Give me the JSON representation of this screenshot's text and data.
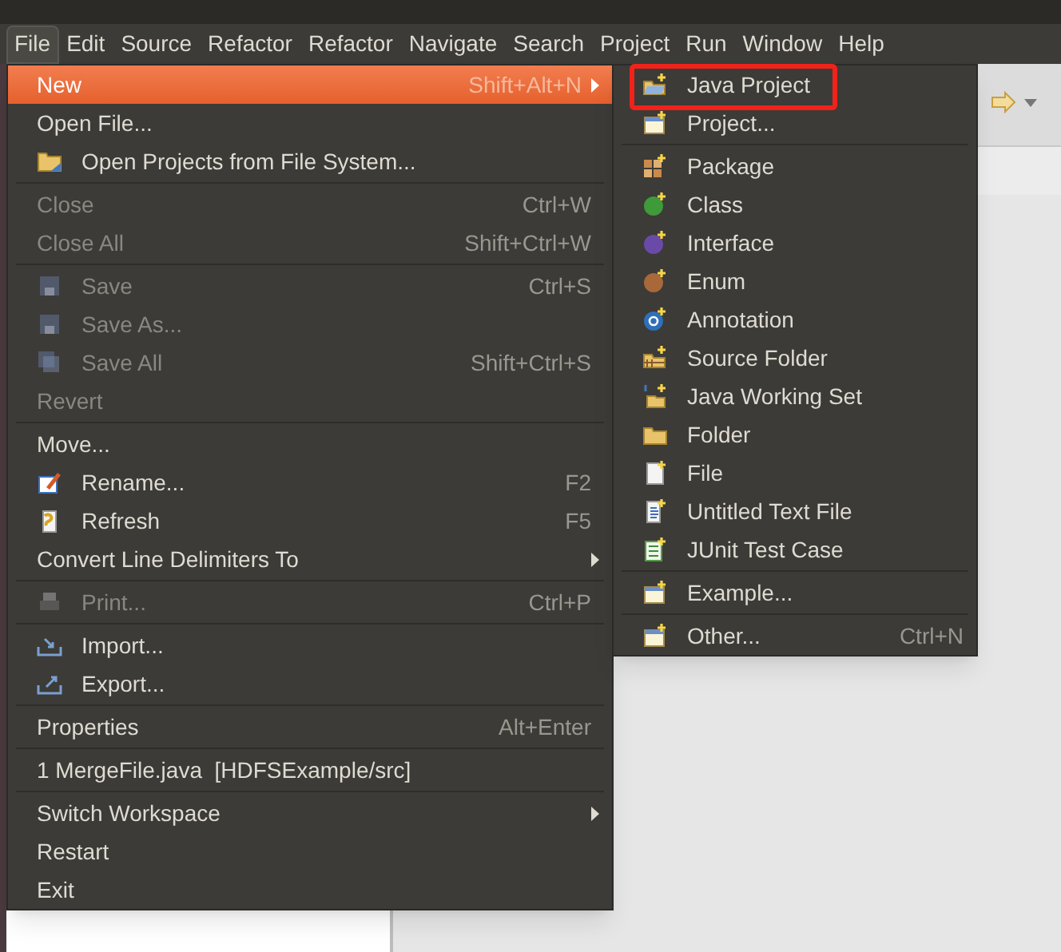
{
  "menubar": [
    {
      "label": "File",
      "selected": true
    },
    {
      "label": "Edit",
      "selected": false
    },
    {
      "label": "Source",
      "selected": false
    },
    {
      "label": "Refactor",
      "selected": false
    },
    {
      "label": "Refactor",
      "selected": false
    },
    {
      "label": "Navigate",
      "selected": false
    },
    {
      "label": "Search",
      "selected": false
    },
    {
      "label": "Project",
      "selected": false
    },
    {
      "label": "Run",
      "selected": false
    },
    {
      "label": "Window",
      "selected": false
    },
    {
      "label": "Help",
      "selected": false
    }
  ],
  "file_menu": [
    {
      "kind": "item",
      "label": "New",
      "shortcut": "Shift+Alt+N",
      "submenu": true,
      "selected": true,
      "disabled": false
    },
    {
      "kind": "item",
      "label": "Open File...",
      "submenu": false,
      "selected": false,
      "disabled": false
    },
    {
      "kind": "item",
      "label": "Open Projects from File System...",
      "submenu": false,
      "selected": false,
      "disabled": false
    },
    {
      "kind": "separator"
    },
    {
      "kind": "item",
      "label": "Close",
      "shortcut": "Ctrl+W",
      "submenu": false,
      "selected": false,
      "disabled": true
    },
    {
      "kind": "item",
      "label": "Close All",
      "shortcut": "Shift+Ctrl+W",
      "submenu": false,
      "selected": false,
      "disabled": true
    },
    {
      "kind": "separator"
    },
    {
      "kind": "item",
      "label": "Save",
      "shortcut": "Ctrl+S",
      "submenu": false,
      "selected": false,
      "disabled": true
    },
    {
      "kind": "item",
      "label": "Save As...",
      "submenu": false,
      "selected": false,
      "disabled": true
    },
    {
      "kind": "item",
      "label": "Save All",
      "shortcut": "Shift+Ctrl+S",
      "submenu": false,
      "selected": false,
      "disabled": true
    },
    {
      "kind": "item",
      "label": "Revert",
      "submenu": false,
      "selected": false,
      "disabled": true
    },
    {
      "kind": "separator"
    },
    {
      "kind": "item",
      "label": "Move...",
      "submenu": false,
      "selected": false,
      "disabled": false
    },
    {
      "kind": "item",
      "label": "Rename...",
      "shortcut": "F2",
      "submenu": false,
      "selected": false,
      "disabled": false
    },
    {
      "kind": "item",
      "label": "Refresh",
      "shortcut": "F5",
      "submenu": false,
      "selected": false,
      "disabled": false
    },
    {
      "kind": "item",
      "label": "Convert Line Delimiters To",
      "submenu": true,
      "selected": false,
      "disabled": false
    },
    {
      "kind": "separator"
    },
    {
      "kind": "item",
      "label": "Print...",
      "shortcut": "Ctrl+P",
      "submenu": false,
      "selected": false,
      "disabled": true
    },
    {
      "kind": "separator"
    },
    {
      "kind": "item",
      "label": "Import...",
      "submenu": false,
      "selected": false,
      "disabled": false
    },
    {
      "kind": "item",
      "label": "Export...",
      "submenu": false,
      "selected": false,
      "disabled": false
    },
    {
      "kind": "separator"
    },
    {
      "kind": "item",
      "label": "Properties",
      "shortcut": "Alt+Enter",
      "submenu": false,
      "selected": false,
      "disabled": false
    },
    {
      "kind": "separator"
    },
    {
      "kind": "item",
      "label": "1 MergeFile.java  [HDFSExample/src]",
      "submenu": false,
      "selected": false,
      "disabled": false
    },
    {
      "kind": "separator"
    },
    {
      "kind": "item",
      "label": "Switch Workspace",
      "submenu": true,
      "selected": false,
      "disabled": false
    },
    {
      "kind": "item",
      "label": "Restart",
      "submenu": false,
      "selected": false,
      "disabled": false
    },
    {
      "kind": "item",
      "label": "Exit",
      "submenu": false,
      "selected": false,
      "disabled": false
    }
  ],
  "new_submenu": [
    {
      "kind": "item",
      "label": "Java Project",
      "highlighted": true
    },
    {
      "kind": "item",
      "label": "Project...",
      "highlighted": false
    },
    {
      "kind": "separator"
    },
    {
      "kind": "item",
      "label": "Package",
      "highlighted": false
    },
    {
      "kind": "item",
      "label": "Class",
      "highlighted": false
    },
    {
      "kind": "item",
      "label": "Interface",
      "highlighted": false
    },
    {
      "kind": "item",
      "label": "Enum",
      "highlighted": false
    },
    {
      "kind": "item",
      "label": "Annotation",
      "highlighted": false
    },
    {
      "kind": "item",
      "label": "Source Folder",
      "highlighted": false
    },
    {
      "kind": "item",
      "label": "Java Working Set",
      "highlighted": false
    },
    {
      "kind": "item",
      "label": "Folder",
      "highlighted": false
    },
    {
      "kind": "item",
      "label": "File",
      "highlighted": false
    },
    {
      "kind": "item",
      "label": "Untitled Text File",
      "highlighted": false
    },
    {
      "kind": "item",
      "label": "JUnit Test Case",
      "highlighted": false
    },
    {
      "kind": "separator"
    },
    {
      "kind": "item",
      "label": "Example...",
      "highlighted": false
    },
    {
      "kind": "separator"
    },
    {
      "kind": "item",
      "label": "Other...",
      "shortcut": "Ctrl+N",
      "highlighted": false
    }
  ]
}
